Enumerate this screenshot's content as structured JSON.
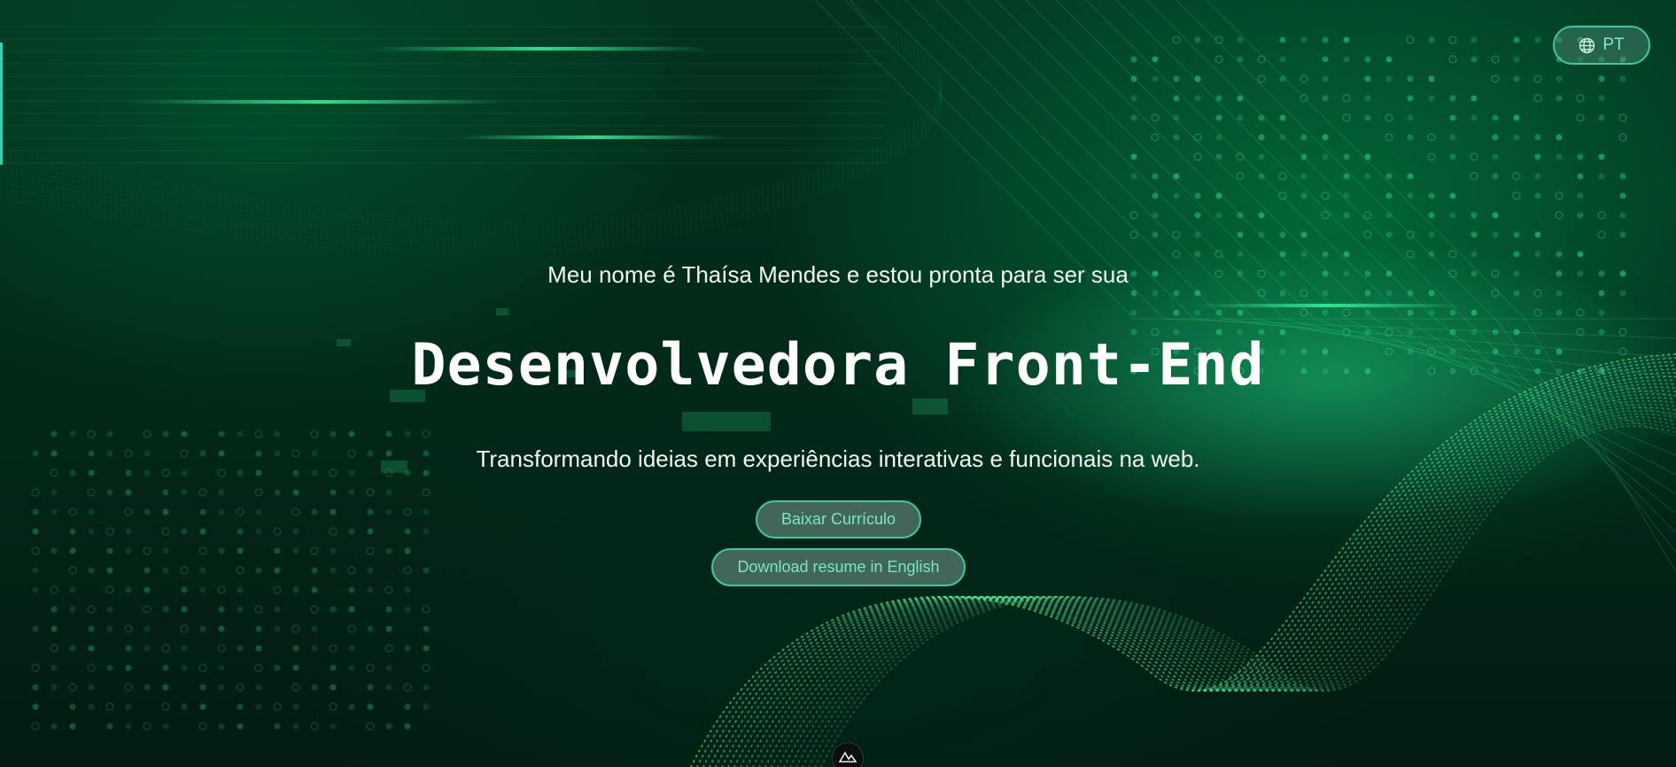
{
  "language_toggle": {
    "label": "PT",
    "icon": "globe-icon"
  },
  "hero": {
    "intro": "Meu nome é Thaísa Mendes e estou pronta para ser sua",
    "title": "Desenvolvedora Front-End",
    "subtitle": "Transformando ideias em experiências interativas e funcionais na web."
  },
  "buttons": {
    "download_cv": "Baixar Currículo",
    "download_cv_english": "Download resume in English"
  },
  "bottom_badge": {
    "icon": "mountain-logo-icon"
  },
  "colors": {
    "accent": "#3ec9a3",
    "button_text": "#78e6c6",
    "background": "#022a19"
  }
}
